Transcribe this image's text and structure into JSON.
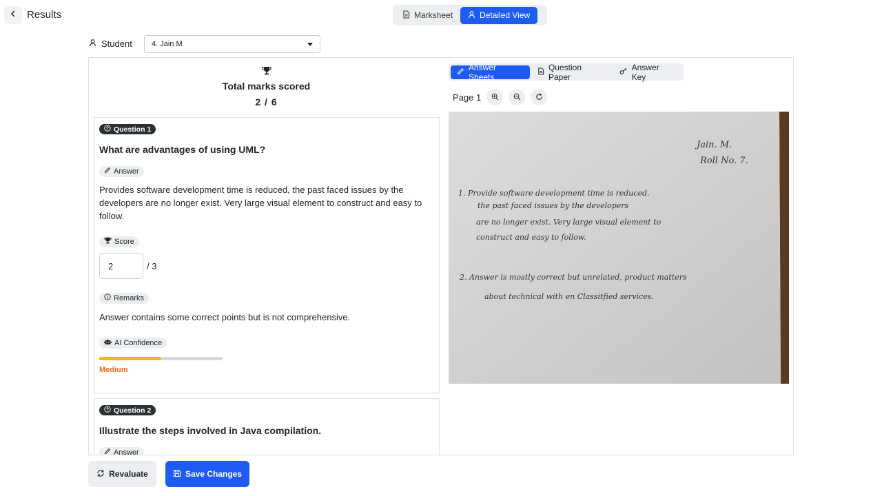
{
  "header": {
    "title": "Results",
    "view_tabs": [
      {
        "label": "Marksheet",
        "active": false
      },
      {
        "label": "Detailed View",
        "active": true
      }
    ]
  },
  "student": {
    "label": "Student",
    "selected": "4. Jain M"
  },
  "summary": {
    "heading": "Total marks scored",
    "score": "2 / 6"
  },
  "questions": [
    {
      "badge": "Question 1",
      "title": "What are advantages of using UML?",
      "answer_label": "Answer",
      "answer": "Provides software development time is reduced, the past faced issues by the developers are no longer exist. Very large visual element to construct and easy to follow.",
      "score_label": "Score",
      "score_value": "2",
      "score_max": "/ 3",
      "remarks_label": "Remarks",
      "remarks": "Answer contains some correct points but is not comprehensive.",
      "confidence_label": "AI Confidence",
      "confidence_level": "Medium",
      "confidence_fraction": 0.5
    },
    {
      "badge": "Question 2",
      "title": "Illustrate the steps involved in Java compilation.",
      "answer_label": "Answer"
    }
  ],
  "viewer": {
    "tabs": [
      {
        "label": "Answer Sheets",
        "active": true
      },
      {
        "label": "Question Paper",
        "active": false
      },
      {
        "label": "Answer Key",
        "active": false
      }
    ],
    "page_label": "Page 1",
    "handwriting": {
      "name_line1": "Jain. M.",
      "name_line2": "Roll No. 7.",
      "answer1": [
        "1. Provide software development time is reduced.",
        "the past faced issues by the developers",
        "are no longer exist. Very large visual element to",
        "construct and easy to follow."
      ],
      "answer2": [
        "2. Answer is mostly correct but unrelated, product matters",
        "about technical with en Classitfied services."
      ]
    }
  },
  "footer": {
    "revaluate": "Revaluate",
    "save": "Save Changes"
  },
  "colors": {
    "accent": "#1d5bf2",
    "badge_dark": "#2b2f36",
    "confidence_fill": "#f5b60d",
    "confidence_text": "#f06a18"
  }
}
